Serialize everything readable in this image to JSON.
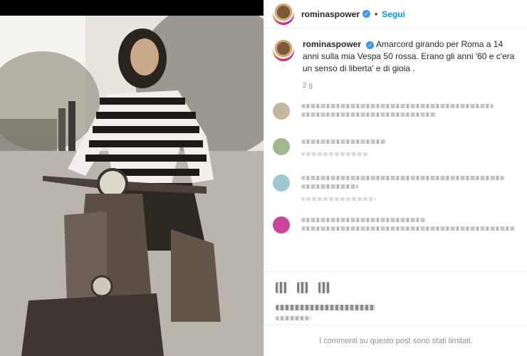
{
  "header": {
    "username": "rominaspower",
    "separator": "•",
    "follow_label": "Segui"
  },
  "caption": {
    "username": "rominaspower",
    "text": "Amarcord girando per Roma a 14 anni sulla mia Vespa 50 rossa. Erano gli anni '60 e c'era un senso di liberta' e di gioia .",
    "time": "2 g"
  },
  "comments": [
    {
      "avatar_color": "#c8b59e"
    },
    {
      "avatar_color": "#9fb88f"
    },
    {
      "avatar_color": "#9fc7d3"
    },
    {
      "avatar_color": "#c9459a"
    }
  ],
  "icons": [
    "heart-icon",
    "comment-icon",
    "share-icon",
    "bookmark-icon"
  ],
  "footer": {
    "limited_text": "I commenti su questo post sono stati limitati."
  }
}
